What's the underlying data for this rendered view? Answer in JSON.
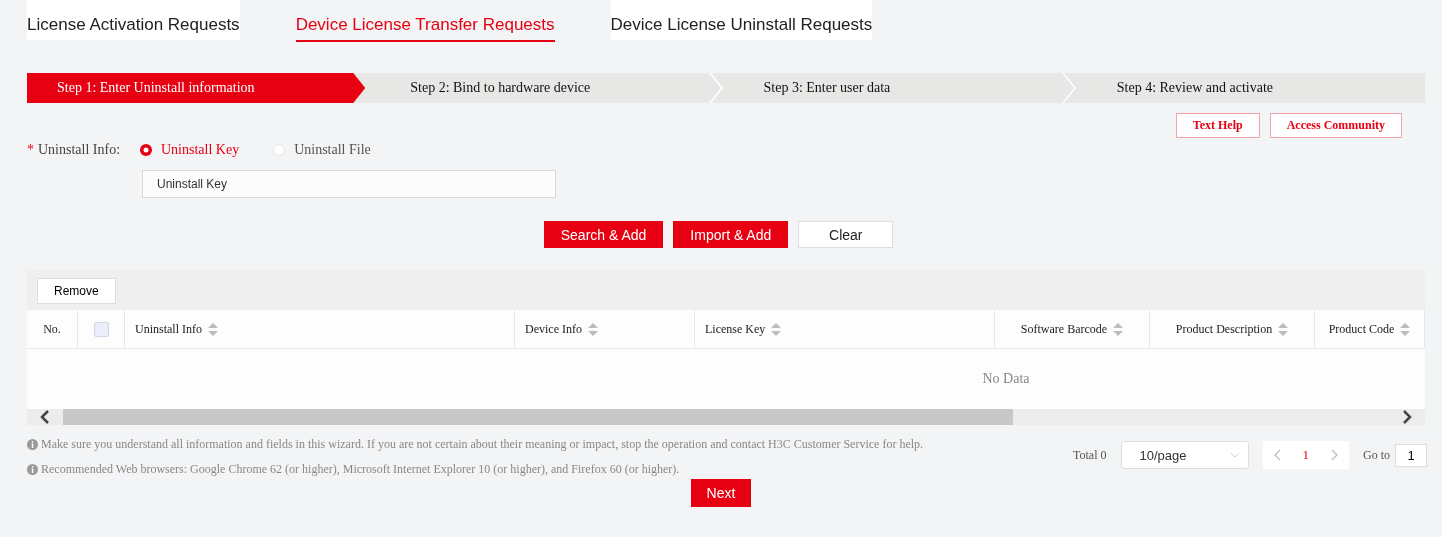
{
  "tabs": [
    {
      "label": "License Activation Requests",
      "selected": false
    },
    {
      "label": "Device License Transfer Requests",
      "selected": true
    },
    {
      "label": "Device License Uninstall Requests",
      "selected": false
    }
  ],
  "steps": [
    {
      "label": "Step 1: Enter Uninstall information",
      "selected": true
    },
    {
      "label": "Step 2: Bind to hardware device",
      "selected": false
    },
    {
      "label": "Step 3: Enter user data",
      "selected": false
    },
    {
      "label": "Step 4: Review and activate",
      "selected": false
    }
  ],
  "help_links": [
    "Text Help",
    "Access Community"
  ],
  "form": {
    "required_mark": "*",
    "label": "Uninstall Info:",
    "options": [
      {
        "label": "Uninstall Key",
        "selected": true
      },
      {
        "label": "Uninstall File",
        "selected": false
      }
    ],
    "input": {
      "placeholder": "Uninstall Key"
    }
  },
  "action_buttons": [
    {
      "label": "Search & Add",
      "kind": "primary"
    },
    {
      "label": "Import & Add",
      "kind": "primary"
    },
    {
      "label": "Clear",
      "kind": "plain"
    }
  ],
  "table": {
    "toolbar_button": "Remove",
    "columns": [
      {
        "kind": "text",
        "label": "No."
      },
      {
        "kind": "checkbox",
        "checked": false
      },
      {
        "kind": "sortable",
        "label": "Uninstall Info"
      },
      {
        "kind": "sortable",
        "label": "Device Info"
      },
      {
        "kind": "sortable",
        "label": "License Key"
      },
      {
        "kind": "sortable",
        "label": "Software Barcode"
      },
      {
        "kind": "sortable",
        "label": "Product Description"
      },
      {
        "kind": "sortable",
        "label": "Product Code"
      }
    ],
    "empty_text": "No Data"
  },
  "notes": [
    "Make sure you understand all information and fields in this wizard. If you are not certain about their meaning or impact, stop the operation and contact H3C Customer Service for help.",
    "Recommended Web browsers: Google Chrome 62 (or higher), Microsoft Internet Explorer 10 (or higher), and Firefox 60 (or higher)."
  ],
  "pagination": {
    "total": "Total 0",
    "page_size": "10/page",
    "pages": [
      {
        "label": "1",
        "selected": true
      }
    ],
    "goto_label": "Go to",
    "goto_value": "1"
  },
  "next_button": "Next"
}
